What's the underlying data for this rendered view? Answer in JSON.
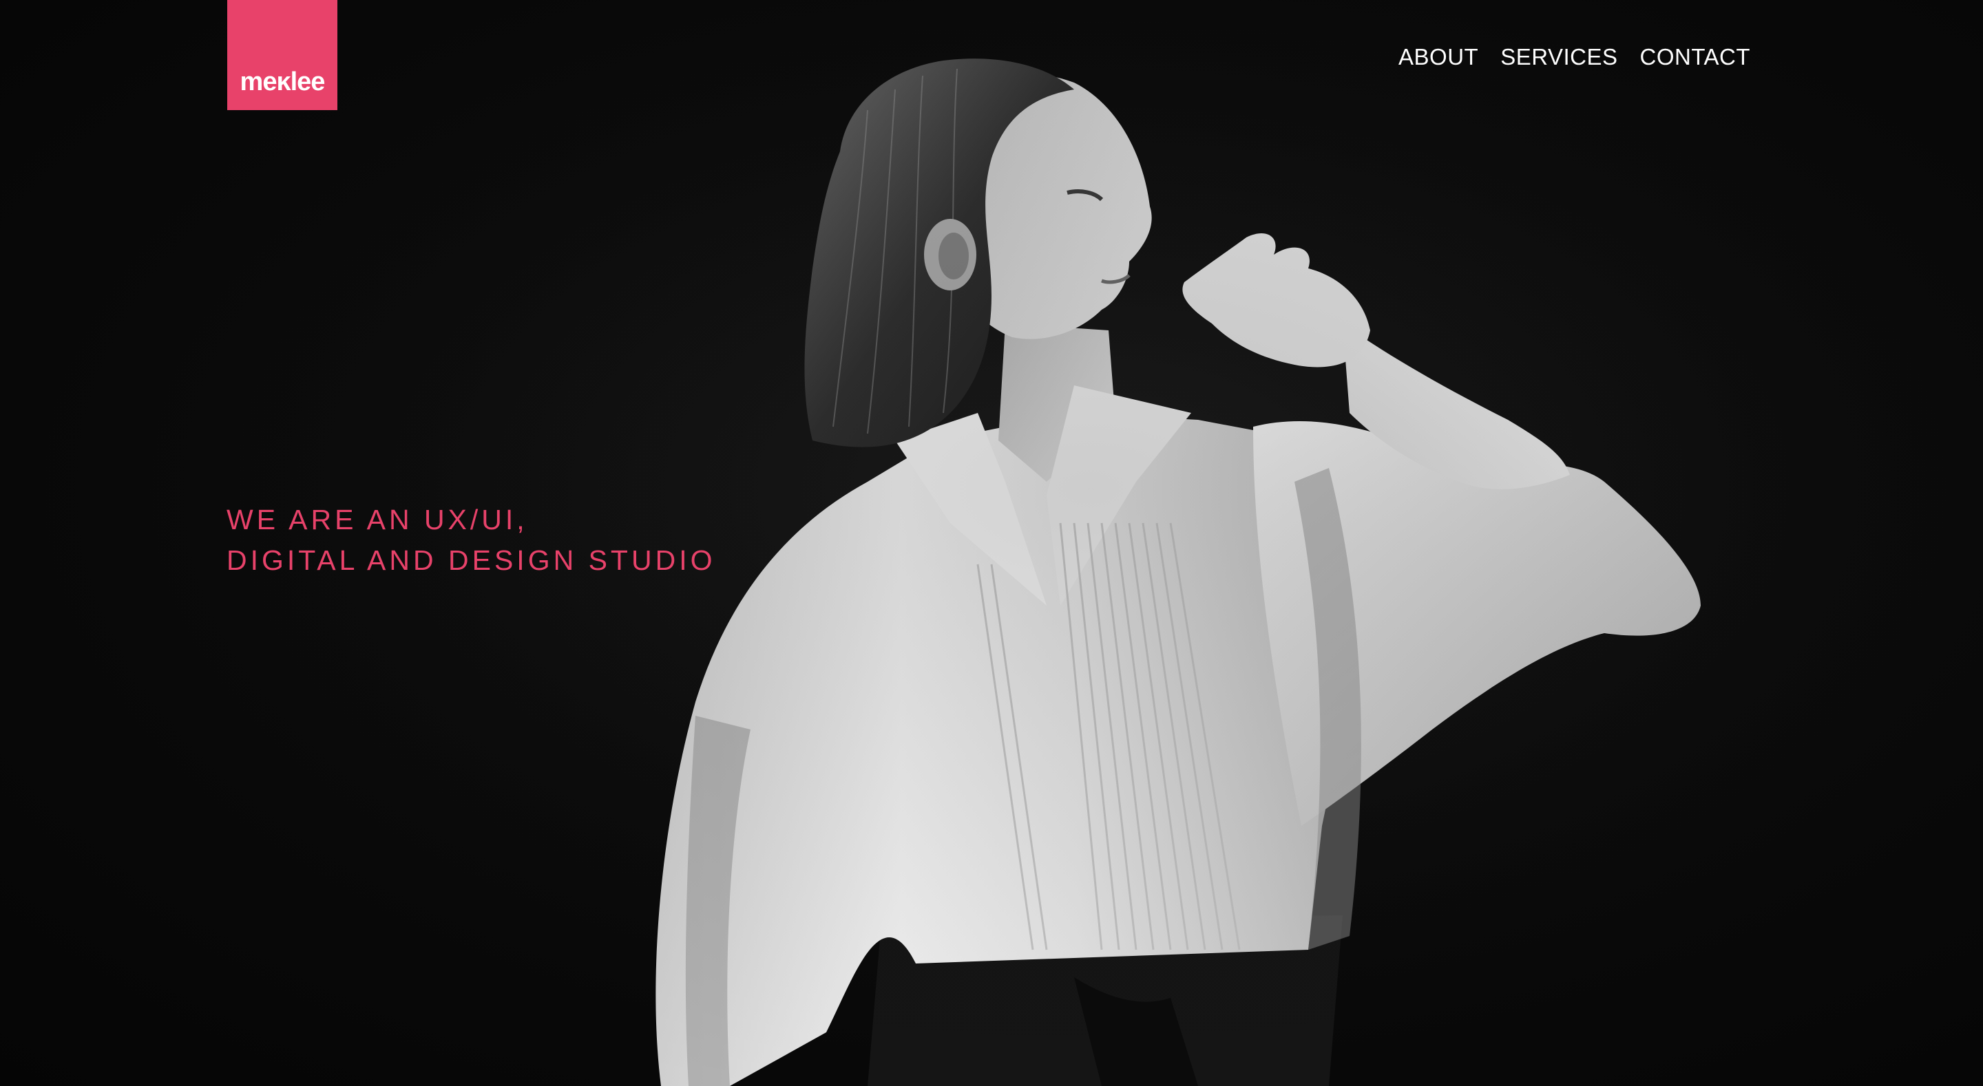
{
  "brand": {
    "logo_text": "meĸlee",
    "accent_color": "#e8426a"
  },
  "nav": {
    "items": [
      {
        "label": "ABOUT"
      },
      {
        "label": "SERVICES"
      },
      {
        "label": "CONTACT"
      }
    ]
  },
  "hero": {
    "tagline_line_1": "WE ARE AN UX/UI,",
    "tagline_line_2": "DIGITAL AND DESIGN STUDIO",
    "background_color": "#060606",
    "photo_subject": "black-and-white portrait of a woman in a white pleated shirt"
  }
}
